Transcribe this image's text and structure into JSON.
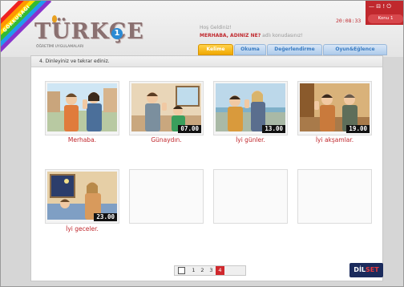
{
  "header": {
    "badge": "GÖKKUŞAĞI",
    "logo": {
      "title": "TÜRKÇE",
      "number": "1",
      "subtitle": "ÖĞRETİMİ UYGULAMALARI"
    },
    "welcome": "Hoş Geldiniz!",
    "prompt_bold": "MERHABA, ADINIZ NE?",
    "prompt_light": "adlı konudasınız!",
    "time": "20:08:33",
    "window_controls": "— ⊟ ! ⏻",
    "konu_label": "Konu 1"
  },
  "tabs": [
    {
      "label": "Kelime",
      "active": true
    },
    {
      "label": "Okuma",
      "active": false
    },
    {
      "label": "Değerlendirme",
      "active": false
    },
    {
      "label": "Oyun&Eğlence",
      "active": false
    }
  ],
  "instruction": "4. Dinleyiniz ve tekrar ediniz.",
  "cards": [
    {
      "caption": "Merhaba.",
      "time": ""
    },
    {
      "caption": "Günaydın.",
      "time": "07.00"
    },
    {
      "caption": "İyi günler.",
      "time": "13.00"
    },
    {
      "caption": "İyi akşamlar.",
      "time": "19.00"
    },
    {
      "caption": "İyi geceler.",
      "time": "23.00"
    }
  ],
  "pager": {
    "pages": [
      "1",
      "2",
      "3",
      "4"
    ],
    "active_page": "4"
  },
  "brand": {
    "part1": "DİL",
    "part2": "SET"
  },
  "colors": {
    "accent_red": "#c0282d",
    "tab_active": "#f0a800",
    "tab_blue": "#3a7cc2",
    "brand_navy": "#1b2b5c"
  }
}
